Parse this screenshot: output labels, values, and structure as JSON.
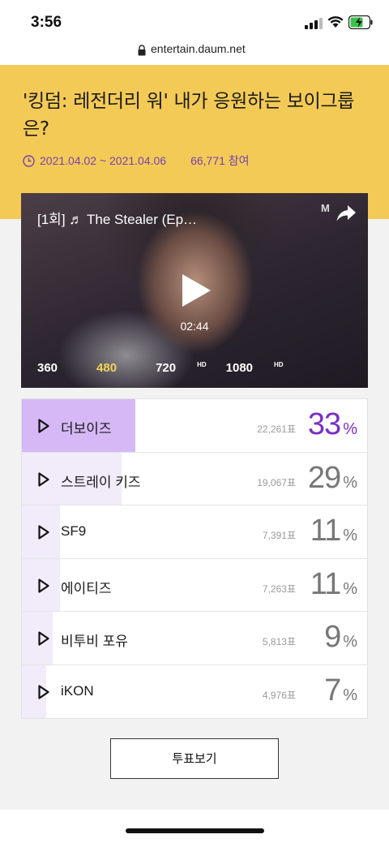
{
  "status": {
    "time": "3:56"
  },
  "browser": {
    "url": "entertain.daum.net"
  },
  "poll": {
    "title": "'킹덤: 레전더리 워' 내가 응원하는 보이그룹은?",
    "period": "2021.04.02 ~ 2021.04.06",
    "participants": "66,771 참여"
  },
  "video": {
    "title": "[1회] ♬ The Stealer (Ep…",
    "channel_logo": "M",
    "duration": "02:44",
    "qualities": [
      "360",
      "480",
      "720",
      "1080"
    ],
    "hd_badge": "HD",
    "selected_quality": "480"
  },
  "options": [
    {
      "name": "더보이즈",
      "votes": "22,261표",
      "percent": "33",
      "sign": "%",
      "share": 33
    },
    {
      "name": "스트레이 키즈",
      "votes": "19,067표",
      "percent": "29",
      "sign": "%",
      "share": 29
    },
    {
      "name": "SF9",
      "votes": "7,391표",
      "percent": "11",
      "sign": "%",
      "share": 11
    },
    {
      "name": "에이티즈",
      "votes": "7,263표",
      "percent": "11",
      "sign": "%",
      "share": 11
    },
    {
      "name": "비투비 포유",
      "votes": "5,813표",
      "percent": "9",
      "sign": "%",
      "share": 9
    },
    {
      "name": "iKON",
      "votes": "4,976표",
      "percent": "7",
      "sign": "%",
      "share": 7
    }
  ],
  "actions": {
    "vote_button": "투표보기"
  },
  "colors": {
    "header_bg": "#f4ca56",
    "accent": "#7a2ec8",
    "leader_fill": "#d5b8f5",
    "fill": "#f1ebfa"
  }
}
